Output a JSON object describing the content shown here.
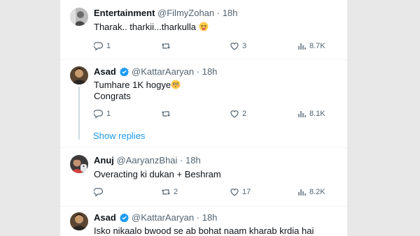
{
  "posts": [
    {
      "name": "Entertainment",
      "handle": "@FilmyZohan",
      "time": "18h",
      "text": "Tharak.. tharkii...tharkulla",
      "emoji": "tongue-wink-face",
      "replies": "1",
      "reposts": "",
      "likes": "3",
      "views": "8.7K",
      "verified": false
    },
    {
      "name": "Asad",
      "handle": "@KattarAaryan",
      "time": "18h",
      "text": "Tumhare 1K hogye",
      "emoji": "flushed-face",
      "text2": "Congrats",
      "replies": "1",
      "reposts": "",
      "likes": "2",
      "views": "8.1K",
      "verified": true
    },
    {
      "name": "Anuj",
      "handle": "@AaryanzBhai",
      "time": "18h",
      "text": "Overacting ki dukan + Beshram",
      "replies": "",
      "reposts": "2",
      "likes": "17",
      "views": "8.2K",
      "verified": false
    },
    {
      "name": "Asad",
      "handle": "@KattarAaryan",
      "time": "18h",
      "text": "Isko nikaalo bwood se ab bohat naam kharab krdia hai",
      "verified": true
    }
  ],
  "show_replies": "Show replies",
  "dot": "·",
  "colors": {
    "accent": "#1d9bf0",
    "muted": "#536471",
    "line": "#cfd9de"
  }
}
